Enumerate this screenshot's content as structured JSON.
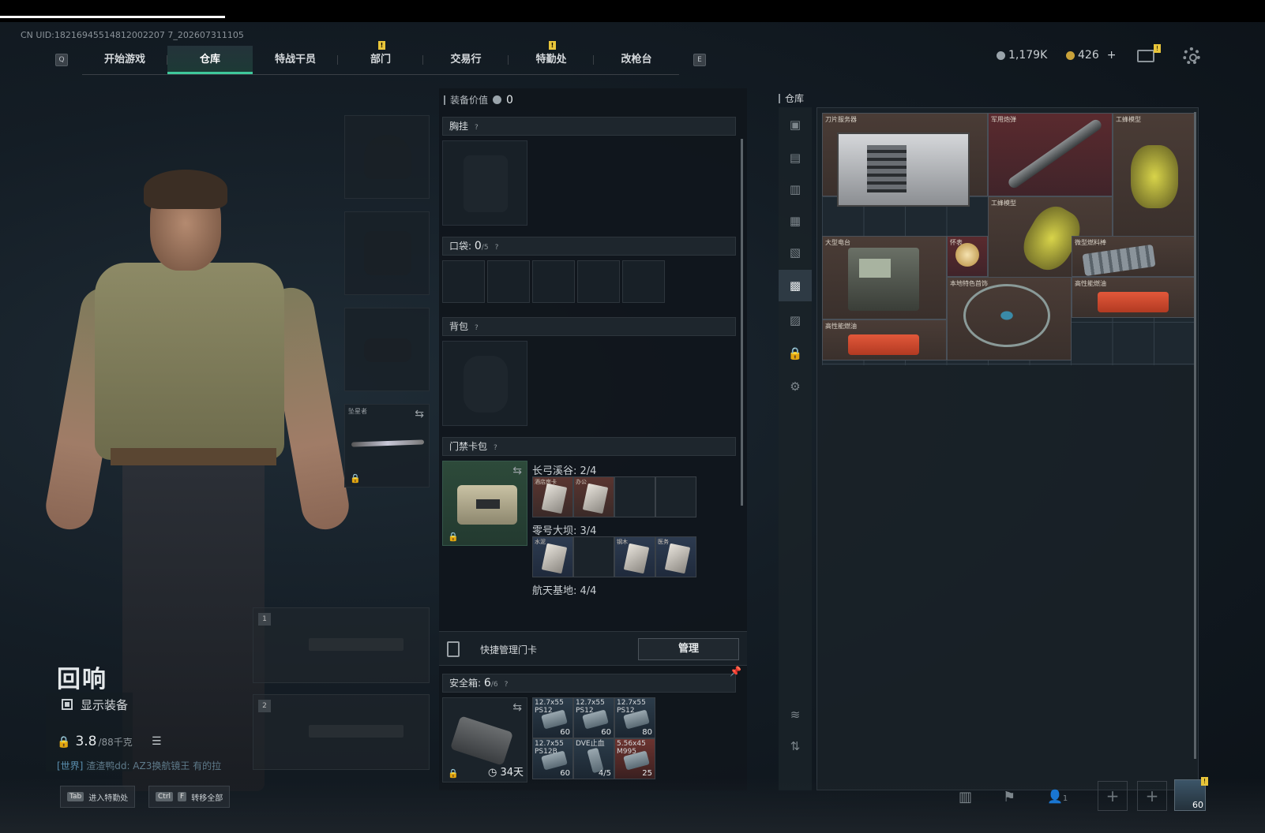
{
  "uid": "CN UID:18216945514812002207 7_202607311105",
  "nav": {
    "left_key": "Q",
    "right_key": "E",
    "tabs": [
      {
        "label": "开始游戏"
      },
      {
        "label": "仓库",
        "active": true
      },
      {
        "label": "特战干员"
      },
      {
        "label": "部门",
        "badge": "!"
      },
      {
        "label": "交易行"
      },
      {
        "label": "特勤处",
        "badge": "!"
      },
      {
        "label": "改枪台"
      }
    ]
  },
  "currency": {
    "silver": "1,179K",
    "gold": "426",
    "gold_add": "+"
  },
  "mail_badge": "!",
  "character": {
    "name": "回响",
    "show_equipment": "显示装备",
    "weight": "3.8",
    "weight_max": "/88千克",
    "chat_channel": "[世界]",
    "chat_text": "渣渣鸭dd: AZ3换航镜王 有的拉"
  },
  "slots": {
    "melee_label": "坠星者",
    "weapon1": "1",
    "weapon2": "2"
  },
  "bottom": {
    "tab_key": "Tab",
    "tab_label": "进入特勤处",
    "ctrl_key": "Ctrl",
    "f_key": "F",
    "ctrl_label": "转移全部",
    "avatar_level": "60",
    "avatar_badge": "!",
    "squad_count": "1"
  },
  "loadout": {
    "title": "装备价值",
    "value": "0",
    "chest_rig": "胸挂",
    "pocket_label": "口袋:",
    "pocket_value": "0",
    "pocket_max": "/5",
    "backpack": "背包",
    "keycard_pack": "门禁卡包",
    "help": "?",
    "keycard_groups": [
      {
        "label": "长弓溪谷: 2/4",
        "cards": [
          "酒店房卡",
          "办公",
          "",
          ""
        ]
      },
      {
        "label": "零号大坝: 3/4",
        "cards": [
          "水泥",
          "",
          "钢木",
          "医务"
        ]
      },
      {
        "label": "航天基地: 4/4"
      }
    ],
    "quick_manage": "快捷管理门卡",
    "manage_btn": "管理",
    "safe_label": "安全箱:",
    "safe_value": "6",
    "safe_max": "/6",
    "safe_days": "34天",
    "ammo": [
      {
        "name": "12.7x55 PS12",
        "count": "60"
      },
      {
        "name": "12.7x55 PS12",
        "count": "60"
      },
      {
        "name": "12.7x55 PS12",
        "count": "80"
      },
      {
        "name": "12.7x55 PS12B",
        "count": "60"
      },
      {
        "name": "DVE止血",
        "count": "4/5"
      },
      {
        "name": "5.56x45 M995",
        "count": "25"
      }
    ]
  },
  "repository": {
    "title": "仓库",
    "items": {
      "server": "刀片服务器",
      "missile": "军用炮弹",
      "bee1": "工蜂模型",
      "bee2": "工蜂模型",
      "radio": "大型电台",
      "watch": "怀表",
      "model_fuel": "微型燃料棒",
      "charm": "本地特色首饰",
      "fuel1": "高性能燃油",
      "fuel2": "高性能燃油"
    }
  }
}
